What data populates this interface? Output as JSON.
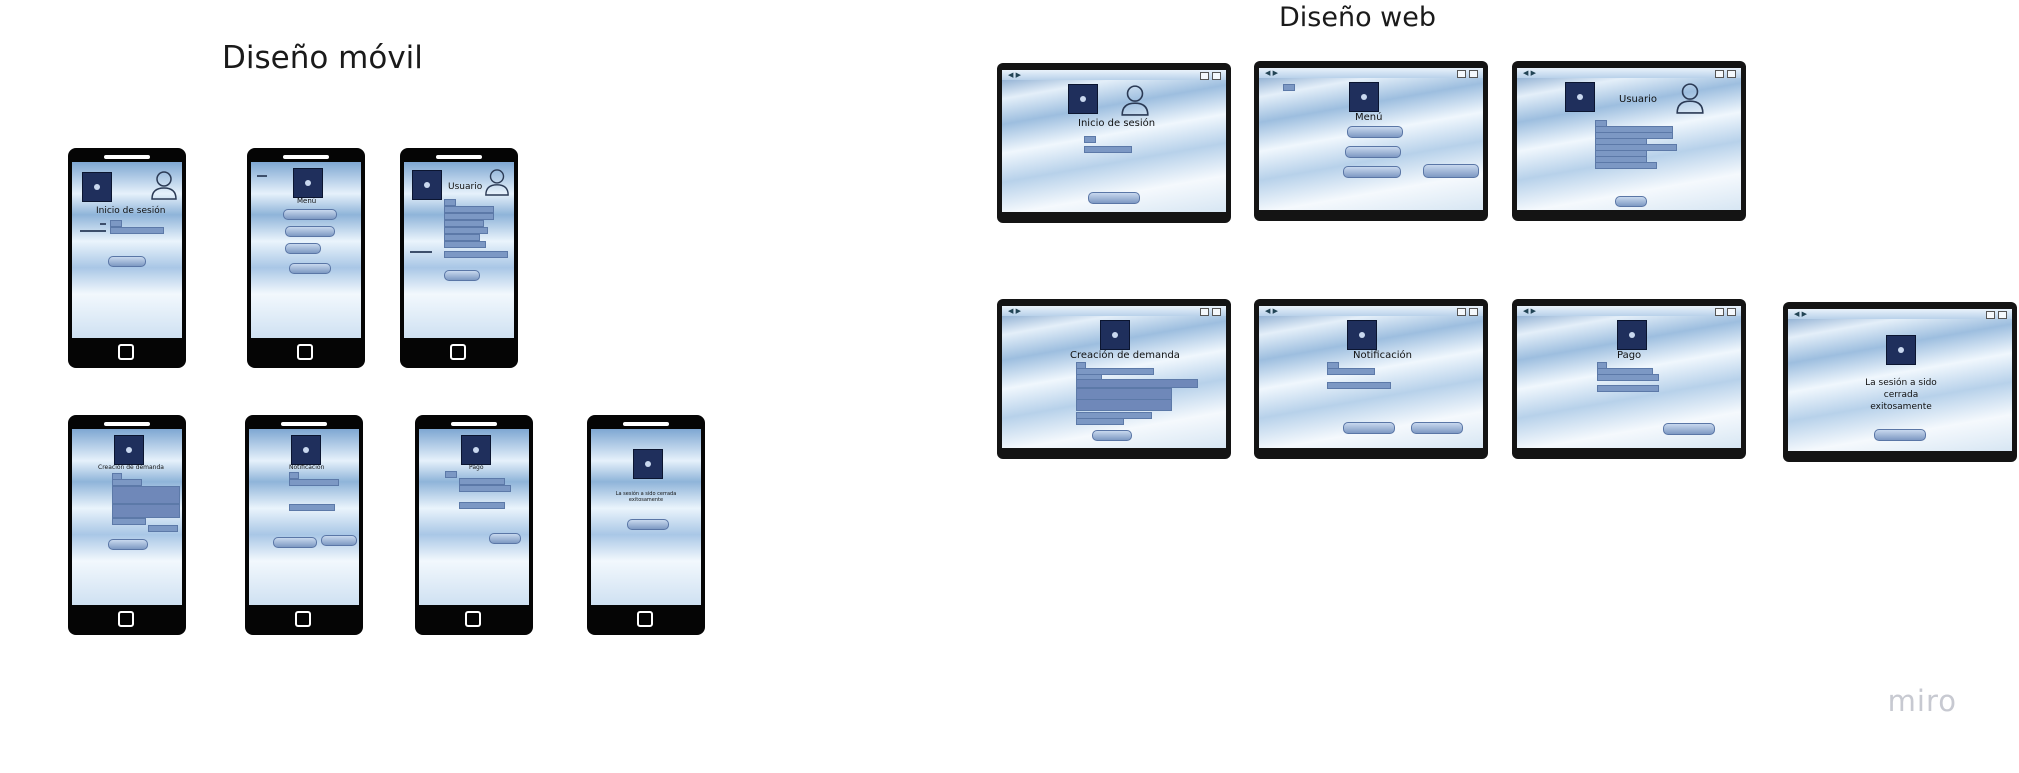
{
  "titles": {
    "mobile": "Diseño móvil",
    "web": "Diseño web"
  },
  "screens": {
    "login": "Inicio de sesión",
    "menu": "Menú",
    "user": "Usuario",
    "demand": "Creación de demanda",
    "notification": "Notificación",
    "payment": "Pago",
    "closed": "La sesión a sido cerrada exitosamente"
  },
  "watermark": "miro",
  "icons": [
    "logo-icon",
    "user-icon",
    "back-arrow-icon",
    "window-controls-icon",
    "home-button-icon"
  ]
}
